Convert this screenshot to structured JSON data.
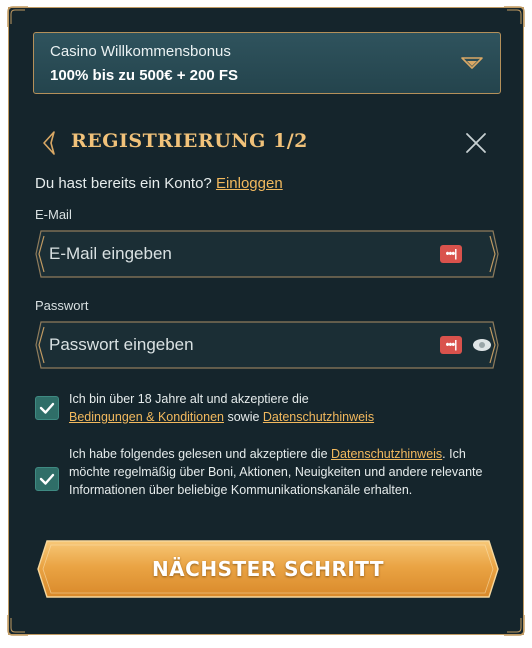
{
  "bonus": {
    "title": "Casino Willkommensbonus",
    "value": "100% bis zu 500€ + 200 FS",
    "chevron_icon": "chevron-down-icon"
  },
  "header": {
    "title": "REGISTRIERUNG 1/2",
    "back_icon": "back-arrow-icon",
    "close_icon": "close-icon"
  },
  "login": {
    "prompt": "Du hast bereits ein Konto?",
    "link": "Einloggen"
  },
  "email": {
    "label": "E-Mail",
    "placeholder": "E-Mail eingeben",
    "badge": "•••|"
  },
  "password": {
    "label": "Passwort",
    "placeholder": "Passwort eingeben",
    "badge": "•••|"
  },
  "consents": [
    {
      "checked": true,
      "text_before": "Ich bin über 18 Jahre alt und akzeptiere die",
      "link1": "Bedingungen & Konditionen",
      "middle": " sowie ",
      "link2": "Datenschutzhinweis"
    },
    {
      "checked": true,
      "text_before": "Ich habe folgendes gelesen und akzeptiere die ",
      "link1": "Datenschutzhinweis",
      "text_after": ". Ich möchte regelmäßig über Boni, Aktionen, Neuigkeiten und andere relevante Informationen über beliebige Kommunikationskanäle erhalten."
    }
  ],
  "cta": {
    "label": "NÄCHSTER SCHRITT"
  },
  "colors": {
    "background": "#15252c",
    "gold": "#c09a62",
    "accent_text": "#f2b95e",
    "button": "#e9a33c",
    "checkbox": "#2f6e68",
    "badge": "#d9524c"
  }
}
